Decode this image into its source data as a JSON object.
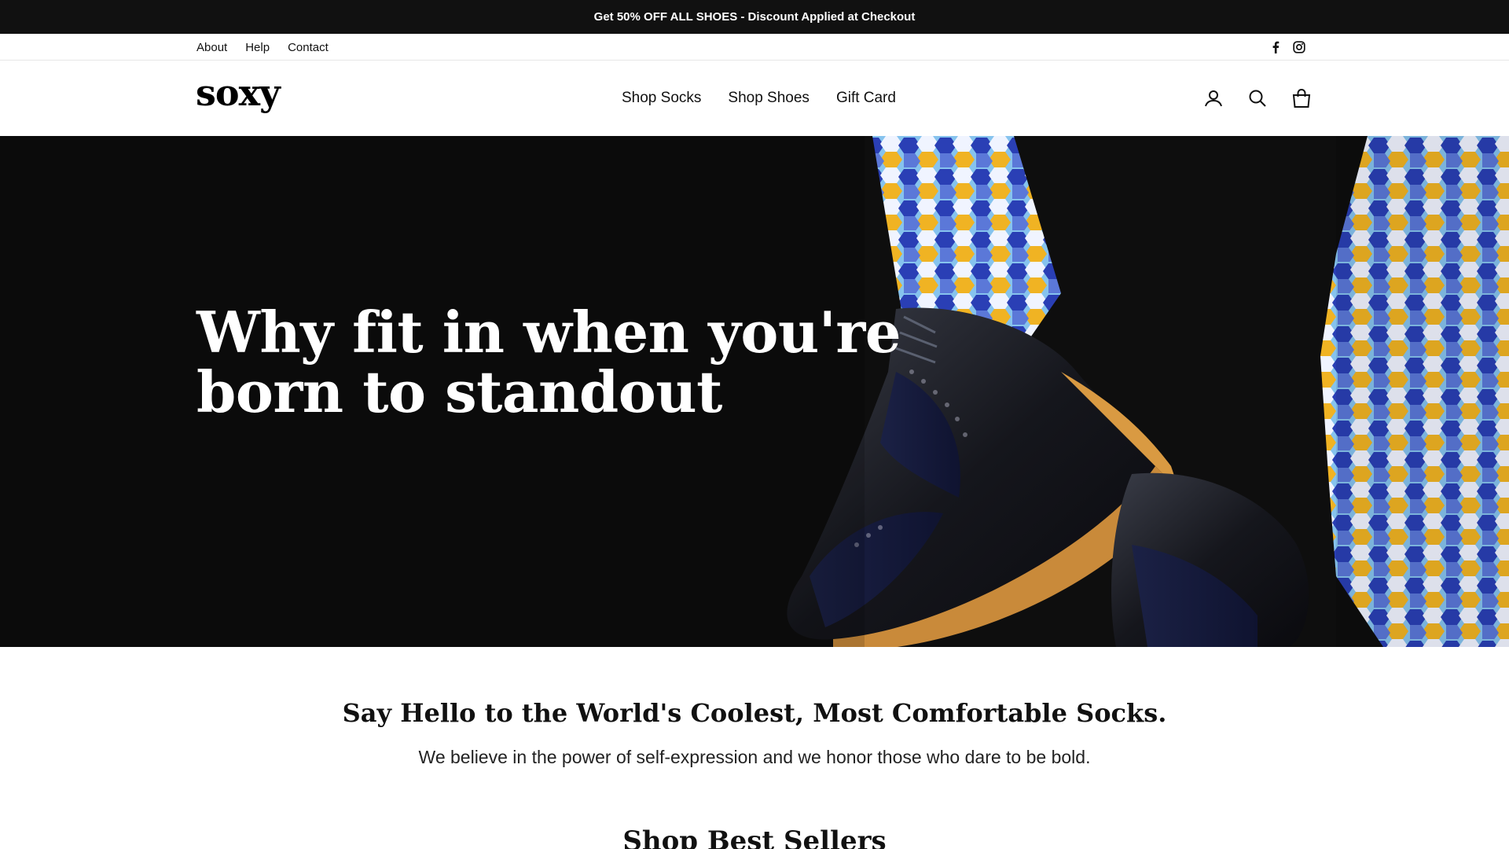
{
  "announcement": {
    "text": "Get 50% OFF ALL SHOES - Discount Applied at Checkout"
  },
  "utility_nav": {
    "links": [
      "About",
      "Help",
      "Contact"
    ],
    "social_icons": [
      "facebook-icon",
      "instagram-icon"
    ]
  },
  "header": {
    "logo": "soxy",
    "nav": [
      "Shop Socks",
      "Shop Shoes",
      "Gift Card"
    ],
    "icons": [
      "account-icon",
      "search-icon",
      "cart-icon"
    ]
  },
  "hero": {
    "title_line1": "Why fit in when you're",
    "title_line2": "born to standout"
  },
  "intro": {
    "heading": "Say Hello to the World's Coolest, Most Comfortable Socks.",
    "text": "We believe in the power of self-expression and we honor those who dare to be bold."
  },
  "best_sellers": {
    "heading": "Shop Best Sellers"
  },
  "colors": {
    "announcement_bg": "#111111",
    "hero_bg": "#0b0b0b",
    "sock_blue": "#2a3fb5",
    "sock_light_blue": "#86c3ee",
    "sock_yellow": "#f0b323",
    "shoe_sole": "#c98a3a"
  }
}
